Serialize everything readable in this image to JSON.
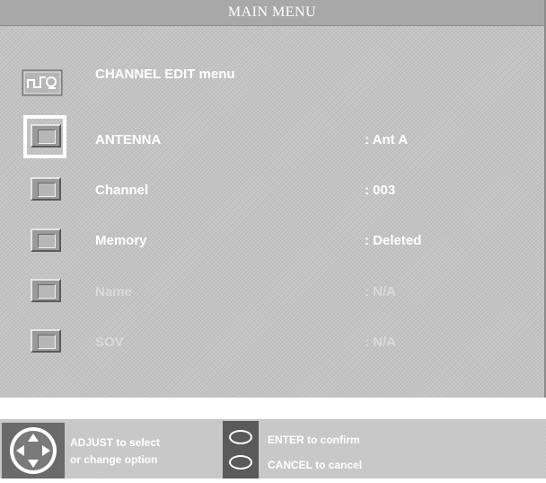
{
  "window": {
    "title": "MAIN MENU"
  },
  "menu": {
    "heading": "CHANNEL EDIT menu",
    "heading_icon": "channel-edit-icon",
    "items": [
      {
        "label": "ANTENNA",
        "value": ": Ant A",
        "enabled": true,
        "selected": true
      },
      {
        "label": "Channel",
        "value": ": 003",
        "enabled": true,
        "selected": false
      },
      {
        "label": "Memory",
        "value": ": Deleted",
        "enabled": true,
        "selected": false
      },
      {
        "label": "Name",
        "value": ": N/A",
        "enabled": false,
        "selected": false
      },
      {
        "label": "SOV",
        "value": ": N/A",
        "enabled": false,
        "selected": false
      }
    ]
  },
  "footer": {
    "adjust_line1": "ADJUST to select",
    "adjust_line2": "or  change  option",
    "enter_label": "ENTER to confirm",
    "cancel_label": "CANCEL to cancel",
    "dpad_icon": "dpad-icon",
    "button_icon": "oval-button-icon"
  },
  "colors": {
    "panel_bg": "#c4c4c4",
    "title_bar": "#a8a8a8",
    "text_active": "#ffffff",
    "text_disabled": "#d9d9d9",
    "selection_frame": "#ffffff"
  }
}
